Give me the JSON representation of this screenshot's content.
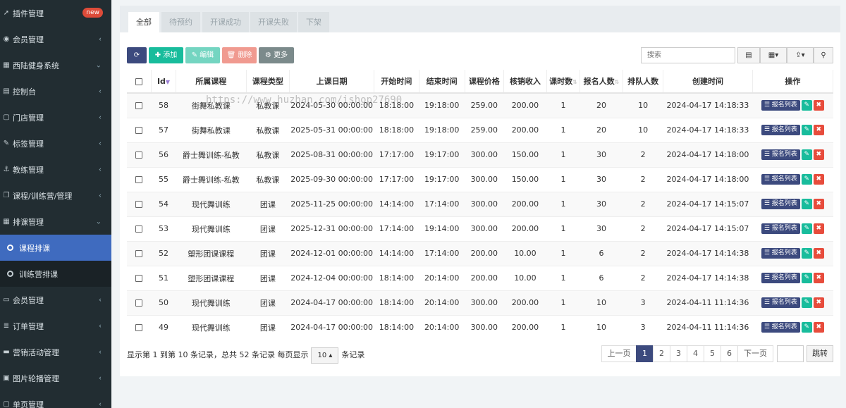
{
  "sidebar": {
    "items": [
      {
        "icon": "rocket-icon",
        "glyph": "➚",
        "label": "插件管理",
        "badge": "new"
      },
      {
        "icon": "user-circle-icon",
        "glyph": "◉",
        "label": "会员管理",
        "arrow": "‹"
      },
      {
        "icon": "building-icon",
        "glyph": "▦",
        "label": "西陆健身系统",
        "arrow": "⌄"
      },
      {
        "icon": "dashboard-icon",
        "glyph": "▤",
        "label": "控制台",
        "arrow": "‹"
      },
      {
        "icon": "store-icon",
        "glyph": "▢",
        "label": "门店管理",
        "arrow": "‹"
      },
      {
        "icon": "tags-icon",
        "glyph": "✎",
        "label": "标签管理",
        "arrow": "‹"
      },
      {
        "icon": "anchor-icon",
        "glyph": "⚓",
        "label": "教练管理",
        "arrow": "‹"
      },
      {
        "icon": "copy-icon",
        "glyph": "❐",
        "label": "课程/训练营/管理",
        "arrow": "‹"
      },
      {
        "icon": "calendar-icon",
        "glyph": "▦",
        "label": "排课管理",
        "arrow": "⌄"
      },
      {
        "icon": "circle-icon",
        "label": "课程排课",
        "sub": true,
        "active": true
      },
      {
        "icon": "circle-icon",
        "label": "训练营排课",
        "sub": true
      },
      {
        "icon": "id-card-icon",
        "glyph": "▭",
        "label": "会员管理",
        "arrow": "‹"
      },
      {
        "icon": "database-icon",
        "glyph": "≣",
        "label": "订单管理",
        "arrow": "‹"
      },
      {
        "icon": "visa-icon",
        "glyph": "▬",
        "label": "营销活动管理",
        "arrow": "‹"
      },
      {
        "icon": "image-icon",
        "glyph": "▣",
        "label": "图片轮播管理",
        "arrow": "‹"
      },
      {
        "icon": "file-icon",
        "glyph": "▢",
        "label": "单页管理",
        "arrow": "‹"
      }
    ]
  },
  "tabs": [
    "全部",
    "待预约",
    "开课成功",
    "开课失败",
    "下架"
  ],
  "toolbar": {
    "refresh_glyph": "⟳",
    "add": "添加",
    "edit": "编辑",
    "delete": "删除",
    "more": "更多",
    "search_placeholder": "搜索"
  },
  "table": {
    "headers": [
      "Id",
      "所属课程",
      "课程类型",
      "上课日期",
      "开始时间",
      "结束时间",
      "课程价格",
      "核销收入",
      "课时数",
      "报名人数",
      "排队人数",
      "创建时间",
      "操作"
    ],
    "rows": [
      [
        "58",
        "街舞私教课",
        "私教课",
        "2024-05-30 00:00:00",
        "18:18:00",
        "19:18:00",
        "259.00",
        "200.00",
        "1",
        "20",
        "10",
        "2024-04-17 14:18:33"
      ],
      [
        "57",
        "街舞私教课",
        "私教课",
        "2025-05-31 00:00:00",
        "18:18:00",
        "19:18:00",
        "259.00",
        "200.00",
        "1",
        "20",
        "10",
        "2024-04-17 14:18:33"
      ],
      [
        "56",
        "爵士舞训练-私教",
        "私教课",
        "2025-08-31 00:00:00",
        "17:17:00",
        "19:17:00",
        "300.00",
        "150.00",
        "1",
        "30",
        "2",
        "2024-04-17 14:18:00"
      ],
      [
        "55",
        "爵士舞训练-私教",
        "私教课",
        "2025-09-30 00:00:00",
        "17:17:00",
        "19:17:00",
        "300.00",
        "150.00",
        "1",
        "30",
        "2",
        "2024-04-17 14:18:00"
      ],
      [
        "54",
        "现代舞训练",
        "团课",
        "2025-11-25 00:00:00",
        "14:14:00",
        "17:14:00",
        "300.00",
        "200.00",
        "1",
        "30",
        "2",
        "2024-04-17 14:15:07"
      ],
      [
        "53",
        "现代舞训练",
        "团课",
        "2025-12-31 00:00:00",
        "17:14:00",
        "19:14:00",
        "300.00",
        "200.00",
        "1",
        "30",
        "2",
        "2024-04-17 14:15:07"
      ],
      [
        "52",
        "塑形团课课程",
        "团课",
        "2024-12-01 00:00:00",
        "14:14:00",
        "17:14:00",
        "200.00",
        "10.00",
        "1",
        "6",
        "2",
        "2024-04-17 14:14:38"
      ],
      [
        "51",
        "塑形团课课程",
        "团课",
        "2024-12-04 00:00:00",
        "18:14:00",
        "20:14:00",
        "200.00",
        "10.00",
        "1",
        "6",
        "2",
        "2024-04-17 14:14:38"
      ],
      [
        "50",
        "现代舞训练",
        "团课",
        "2024-04-17 00:00:00",
        "18:14:00",
        "20:14:00",
        "300.00",
        "200.00",
        "1",
        "10",
        "3",
        "2024-04-11 11:14:36"
      ],
      [
        "49",
        "现代舞训练",
        "团课",
        "2024-04-17 00:00:00",
        "18:14:00",
        "20:14:00",
        "300.00",
        "200.00",
        "1",
        "10",
        "3",
        "2024-04-11 11:14:36"
      ]
    ],
    "op_list_label": "报名列表"
  },
  "footer": {
    "info_prefix": "显示第 1 到第 10 条记录，总共 52 条记录 每页显示",
    "page_size": "10",
    "info_suffix": "条记录",
    "prev": "上一页",
    "pages": [
      "1",
      "2",
      "3",
      "4",
      "5",
      "6"
    ],
    "current_page": "1",
    "next": "下一页",
    "jump": "跳转"
  },
  "watermark": "https://www.huzhan.com/ishop27690",
  "colors": {
    "sidebar_bg": "#222d32",
    "active_item": "#3f6bbf",
    "primary": "#3c4a7e",
    "success": "#18bc9c",
    "danger": "#e74c3c"
  }
}
